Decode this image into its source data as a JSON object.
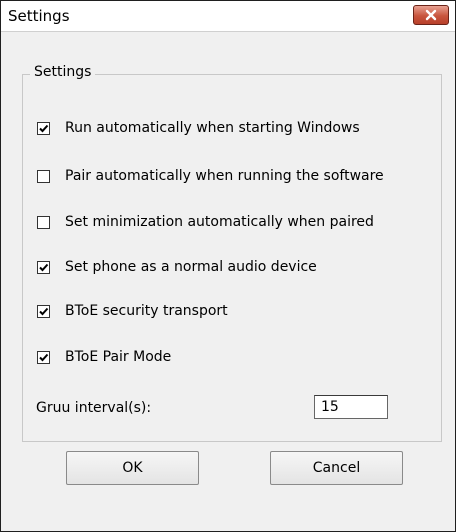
{
  "window": {
    "title": "Settings"
  },
  "group": {
    "label": "Settings"
  },
  "options": [
    {
      "label": "Run automatically when starting Windows",
      "checked": true
    },
    {
      "label": "Pair automatically when running the software",
      "checked": false
    },
    {
      "label": "Set minimization automatically when paired",
      "checked": false
    },
    {
      "label": "Set phone as a normal audio device",
      "checked": true
    },
    {
      "label": "BToE security transport",
      "checked": true
    },
    {
      "label": "BToE Pair Mode",
      "checked": true
    }
  ],
  "interval": {
    "label": "Gruu interval(s):",
    "value": "15"
  },
  "buttons": {
    "ok": "OK",
    "cancel": "Cancel"
  },
  "colors": {
    "close_button": "#c8553e",
    "dialog_background": "#f0f0f0"
  }
}
